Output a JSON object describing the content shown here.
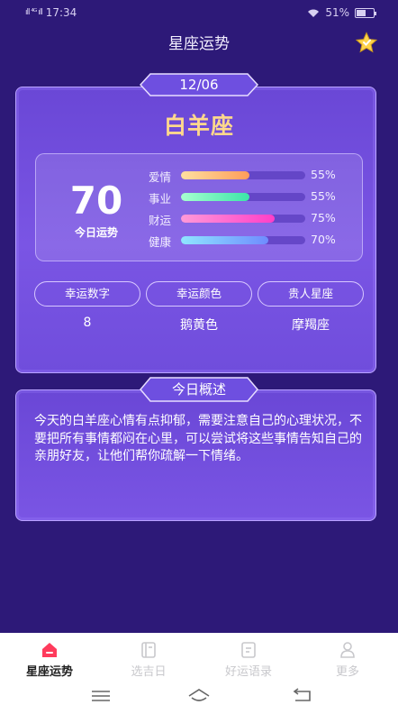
{
  "status_bar": {
    "signal": "ıll ⁴ᴳ ıll",
    "time": "17:34",
    "battery_text": "51%"
  },
  "header": {
    "title": "星座运势"
  },
  "fortune": {
    "date": "12/06",
    "sign": "白羊座",
    "score": "70",
    "score_label": "今日运势",
    "stats": [
      {
        "label": "爱情",
        "percent_text": "55%",
        "value": 55,
        "color_from": "#ffe0a0",
        "color_to": "#ff9c5a"
      },
      {
        "label": "事业",
        "percent_text": "55%",
        "value": 55,
        "color_from": "#a8ffd0",
        "color_to": "#3be6a8"
      },
      {
        "label": "财运",
        "percent_text": "75%",
        "value": 75,
        "color_from": "#ff9ad8",
        "color_to": "#ff3fc8"
      },
      {
        "label": "健康",
        "percent_text": "70%",
        "value": 70,
        "color_from": "#8fe6ff",
        "color_to": "#6f8cff"
      }
    ],
    "lucky": [
      {
        "label": "幸运数字",
        "value": "8"
      },
      {
        "label": "幸运颜色",
        "value": "鹅黄色"
      },
      {
        "label": "贵人星座",
        "value": "摩羯座"
      }
    ]
  },
  "overview": {
    "title": "今日概述",
    "text": "今天的白羊座心情有点抑郁，需要注意自己的心理状况，不要把所有事情都闷在心里，可以尝试将这些事情告知自己的亲朋好友，让他们帮你疏解一下情绪。"
  },
  "bottom_nav": {
    "items": [
      {
        "label": "星座运势",
        "icon": "home-icon",
        "active": true
      },
      {
        "label": "选吉日",
        "icon": "calendar-book-icon",
        "active": false
      },
      {
        "label": "好运语录",
        "icon": "note-icon",
        "active": false
      },
      {
        "label": "更多",
        "icon": "user-icon",
        "active": false
      }
    ]
  },
  "colors": {
    "background": "#2d1978",
    "card": "#7352de",
    "accent_gold": "#ffd88c",
    "active_tab": "#ff3b5c"
  }
}
